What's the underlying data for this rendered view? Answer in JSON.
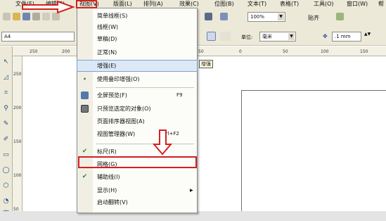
{
  "menubar": {
    "items": [
      "文件(F)",
      "编辑(E)",
      "视图(V)",
      "版面(L)",
      "排列(A)",
      "效果(C)",
      "位图(B)",
      "文本(T)",
      "表格(T)",
      "工具(O)",
      "窗口(W)",
      "帮"
    ]
  },
  "toolbar": {
    "zoom": "100%",
    "snap": "贴齐",
    "page_size": "A4",
    "unit_label": "单位:",
    "unit": "毫米",
    "nudge": ".1 mm"
  },
  "rulers": {
    "h_ticks": [
      "250",
      "200",
      "50",
      "0",
      "50",
      "100",
      "150"
    ],
    "v_ticks": [
      "250",
      "200",
      "150",
      "100",
      "50"
    ]
  },
  "view_menu": {
    "items": [
      {
        "label": "简单线框(S)",
        "shortcut": ""
      },
      {
        "label": "线框(W)",
        "shortcut": ""
      },
      {
        "label": "草稿(D)",
        "shortcut": ""
      },
      {
        "label": "正常(N)",
        "shortcut": ""
      },
      {
        "label": "增强(E)",
        "shortcut": ""
      },
      {
        "label": "使用叠印增强(O)",
        "shortcut": ""
      },
      {
        "label": "全屏预览(F)",
        "shortcut": "F9"
      },
      {
        "label": "只预览选定的对象(O)",
        "shortcut": ""
      },
      {
        "label": "页面排序器视图(A)",
        "shortcut": ""
      },
      {
        "label": "视图管理器(W)",
        "shortcut": "Ctrl+F2"
      },
      {
        "label": "标尺(R)",
        "shortcut": ""
      },
      {
        "label": "网格(G)",
        "shortcut": ""
      },
      {
        "label": "辅助线(I)",
        "shortcut": ""
      },
      {
        "label": "显示(H)",
        "shortcut": ""
      },
      {
        "label": "启动翻转(V)",
        "shortcut": ""
      }
    ],
    "tooltip": "增强"
  },
  "colors": {
    "annotation_red": "#d42020",
    "check_green": "#2e8b2e",
    "highlight": "#dde8f6"
  }
}
